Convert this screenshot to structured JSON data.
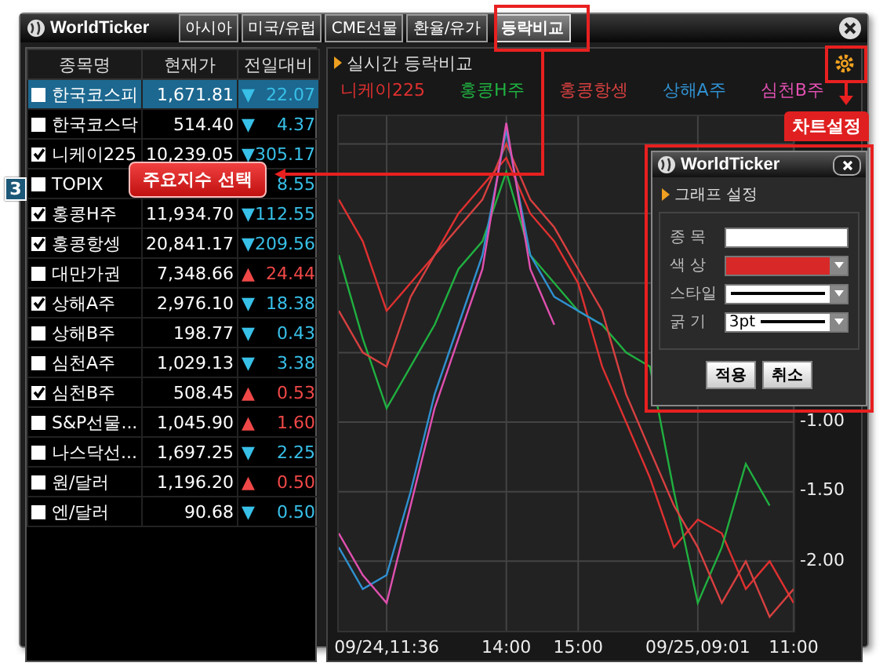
{
  "window": {
    "title": "WorldTicker"
  },
  "tabs": [
    {
      "label": "아시아",
      "selected": false
    },
    {
      "label": "미국/유럽",
      "selected": false
    },
    {
      "label": "CME선물",
      "selected": false
    },
    {
      "label": "환율/유가",
      "selected": false
    },
    {
      "label": "등락비교",
      "selected": true
    }
  ],
  "table": {
    "columns": [
      "종목명",
      "현재가",
      "전일대비"
    ],
    "rows": [
      {
        "name": "한국코스피",
        "checked": false,
        "selected": true,
        "price": "1,671.81",
        "arrow": "▼",
        "rising": false,
        "change": "22.07"
      },
      {
        "name": "한국코스닥",
        "checked": false,
        "selected": false,
        "price": "514.40",
        "arrow": "▼",
        "rising": false,
        "change": "4.37"
      },
      {
        "name": "니케이225",
        "checked": true,
        "selected": false,
        "price": "10,239.05",
        "arrow": "▼",
        "rising": false,
        "change": "305.17"
      },
      {
        "name": "TOPIX",
        "checked": false,
        "selected": false,
        "change": "8.55",
        "rising": false
      },
      {
        "name": "홍콩H주",
        "checked": true,
        "selected": false,
        "price": "11,934.70",
        "arrow": "▼",
        "rising": false,
        "change": "112.55"
      },
      {
        "name": "홍콩항셍",
        "checked": true,
        "selected": false,
        "price": "20,841.17",
        "arrow": "▼",
        "rising": false,
        "change": "209.56"
      },
      {
        "name": "대만가권",
        "checked": false,
        "selected": false,
        "price": "7,348.66",
        "arrow": "▲",
        "rising": true,
        "change": "24.44"
      },
      {
        "name": "상해A주",
        "checked": true,
        "selected": false,
        "price": "2,976.10",
        "arrow": "▼",
        "rising": false,
        "change": "18.38"
      },
      {
        "name": "상해B주",
        "checked": false,
        "selected": false,
        "price": "198.77",
        "arrow": "▼",
        "rising": false,
        "change": "0.43"
      },
      {
        "name": "심천A주",
        "checked": false,
        "selected": false,
        "price": "1,029.13",
        "arrow": "▼",
        "rising": false,
        "change": "3.38"
      },
      {
        "name": "심천B주",
        "checked": true,
        "selected": false,
        "price": "508.45",
        "arrow": "▲",
        "rising": true,
        "change": "0.53"
      },
      {
        "name": "S&P선물...",
        "checked": false,
        "selected": false,
        "price": "1,045.90",
        "arrow": "▲",
        "rising": true,
        "change": "1.60"
      },
      {
        "name": "나스닥선...",
        "checked": false,
        "selected": false,
        "price": "1,697.25",
        "arrow": "▼",
        "rising": false,
        "change": "2.25"
      },
      {
        "name": "원/달러",
        "checked": false,
        "selected": false,
        "price": "1,196.20",
        "arrow": "▲",
        "rising": true,
        "change": "0.50"
      },
      {
        "name": "엔/달러",
        "checked": false,
        "selected": false,
        "price": "90.68",
        "arrow": "▼",
        "rising": false,
        "change": "0.50"
      }
    ]
  },
  "chart": {
    "title": "실시간 등락비교",
    "chart_data": {
      "type": "line",
      "grid": true,
      "ylim": [
        -2.5,
        1.2
      ],
      "yticks": [
        {
          "value": -1,
          "label": "-1.00"
        },
        {
          "value": -1.5,
          "label": "-1.50"
        },
        {
          "value": -2,
          "label": "-2.00"
        }
      ],
      "categories": [
        null,
        null,
        "09/24,11:36",
        null,
        null,
        null,
        null,
        "14:00",
        null,
        null,
        "15:00",
        null,
        null,
        null,
        null,
        "09/25,09:01",
        null,
        null,
        null,
        "11:00"
      ],
      "series": [
        {
          "name": "니케이225",
          "color": "#e03030",
          "values": [
            0.6,
            0.3,
            -0.2,
            0.0,
            0.2,
            0.5,
            0.7,
            0.9,
            0.5,
            0.3,
            0.0,
            -0.6,
            -1.0,
            -1.4,
            -1.9,
            -1.7,
            -1.8,
            -2.2,
            -2.0,
            -2.3
          ]
        },
        {
          "name": "홍콩H주",
          "color": "#20b040",
          "values": [
            0.2,
            -0.4,
            -0.9,
            -0.6,
            -0.3,
            0.1,
            0.3,
            0.8,
            0.2,
            0.0,
            -0.2,
            -0.3,
            -0.5,
            -0.6,
            -1.5,
            -2.3,
            -1.9,
            -1.3,
            -1.6,
            null
          ]
        },
        {
          "name": "홍콩항셍",
          "color": "#d84040",
          "values": [
            -0.2,
            -0.5,
            -0.6,
            -0.1,
            0.2,
            0.4,
            0.6,
            1.0,
            0.6,
            0.4,
            0.1,
            -0.2,
            -0.8,
            -1.2,
            -1.6,
            -1.9,
            -2.3,
            -2.0,
            -2.4,
            -2.2
          ]
        },
        {
          "name": "상해A주",
          "color": "#3090d0",
          "values": [
            -1.9,
            -2.2,
            -2.1,
            -1.5,
            -0.8,
            -0.3,
            0.2,
            1.1,
            0.2,
            -0.1,
            -0.2,
            -0.3,
            null,
            null,
            null,
            null,
            null,
            null,
            null,
            null
          ]
        },
        {
          "name": "심천B주",
          "color": "#e050b0",
          "values": [
            -1.8,
            -2.1,
            -2.3,
            -1.6,
            -0.9,
            -0.4,
            0.1,
            1.15,
            0.1,
            -0.3,
            null,
            null,
            null,
            null,
            null,
            null,
            null,
            null,
            null,
            null
          ]
        }
      ]
    }
  },
  "dialog": {
    "title": "WorldTicker",
    "section": "그래프 설정",
    "fields": [
      {
        "label": "종 목",
        "kind": "text"
      },
      {
        "label": "색 상",
        "kind": "color",
        "color": "#d82828"
      },
      {
        "label": "스타일",
        "kind": "style"
      },
      {
        "label": "굵 기",
        "kind": "width",
        "value": "3pt"
      }
    ],
    "buttons": [
      "적용",
      "취소"
    ]
  },
  "annotations": {
    "step": "3",
    "callout": "주요지수 선택",
    "settings_label": "차트설정"
  }
}
